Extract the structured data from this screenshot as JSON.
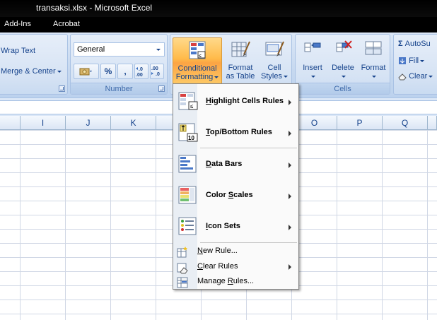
{
  "window": {
    "title": "transaksi.xlsx - Microsoft Excel"
  },
  "ribbon_tabs": [
    "Add-Ins",
    "Acrobat"
  ],
  "alignment": {
    "wrap_text": "Wrap Text",
    "merge_center": "Merge & Center"
  },
  "number": {
    "format_value": "General",
    "group_label": "Number",
    "percent": "%",
    "comma": ",",
    "inc_decimal": ".0 .00",
    "dec_decimal": ".00 .0"
  },
  "styles": {
    "conditional_formatting": [
      "Conditional",
      "Formatting"
    ],
    "format_as_table": [
      "Format",
      "as Table"
    ],
    "cell_styles": [
      "Cell",
      "Styles"
    ]
  },
  "cells": {
    "insert": "Insert",
    "delete": "Delete",
    "format": "Format",
    "group_label": "Cells"
  },
  "editing": {
    "autosum": "AutoSu",
    "fill": "Fill",
    "clear": "Clear"
  },
  "columns": [
    "I",
    "J",
    "K",
    "O",
    "P",
    "Q"
  ],
  "menu": {
    "items": [
      {
        "label": "Highlight Cells Rules",
        "accel": "H",
        "rest": "ighlight Cells Rules"
      },
      {
        "label": "Top/Bottom Rules",
        "accel": "T",
        "rest": "op/Bottom Rules"
      },
      {
        "label": "Data Bars",
        "accel": "D",
        "rest": "ata Bars"
      },
      {
        "label": "Color Scales",
        "pre": "Color ",
        "accel": "S",
        "rest": "cales"
      },
      {
        "label": "Icon Sets",
        "accel": "I",
        "rest": "con Sets"
      }
    ],
    "small_items": [
      {
        "label": "New Rule...",
        "accel": "N",
        "rest": "ew Rule..."
      },
      {
        "label": "Clear Rules",
        "accel": "C",
        "rest": "lear Rules"
      },
      {
        "label": "Manage Rules...",
        "pre": "Manage ",
        "accel": "R",
        "rest": "ules..."
      }
    ]
  },
  "colors": {
    "ribbon": "#c6d8ef",
    "active_button": "#fcb044",
    "title_bar": "#000000",
    "menu_bg": "#fafafa"
  }
}
